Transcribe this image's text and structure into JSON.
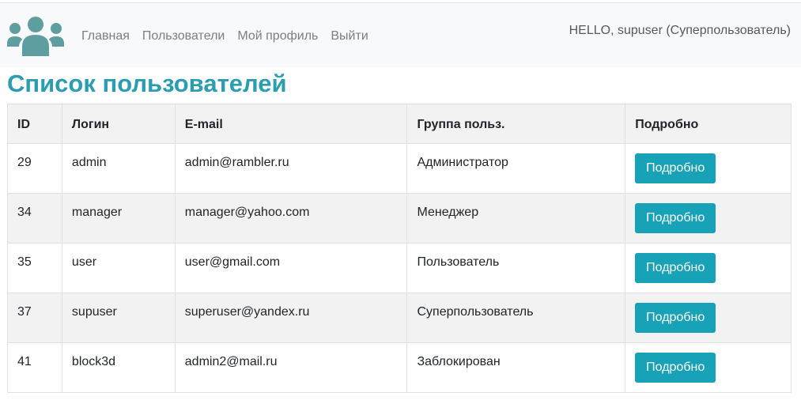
{
  "nav": {
    "links": [
      "Главная",
      "Пользователи",
      "Мой профиль",
      "Выйти"
    ],
    "greeting": "HELLO, supuser (Суперпользователь)"
  },
  "page": {
    "title": "Список пользователей"
  },
  "table": {
    "headers": [
      "ID",
      "Логин",
      "E-mail",
      "Группа польз.",
      "Подробно"
    ],
    "rows": [
      {
        "id": "29",
        "login": "admin",
        "email": "admin@rambler.ru",
        "group": "Администратор",
        "action": "Подробно"
      },
      {
        "id": "34",
        "login": "manager",
        "email": "manager@yahoo.com",
        "group": "Менеджер",
        "action": "Подробно"
      },
      {
        "id": "35",
        "login": "user",
        "email": "user@gmail.com",
        "group": "Пользователь",
        "action": "Подробно"
      },
      {
        "id": "37",
        "login": "supuser",
        "email": "superuser@yandex.ru",
        "group": "Суперпользователь",
        "action": "Подробно"
      },
      {
        "id": "41",
        "login": "block3d",
        "email": "admin2@mail.ru",
        "group": "Заблокирован",
        "action": "Подробно"
      }
    ]
  },
  "colors": {
    "accent": "#17a2b8",
    "title": "#2a9db0",
    "logo": "#5f9ea0"
  },
  "icons": {
    "logo": "users-group-icon"
  }
}
